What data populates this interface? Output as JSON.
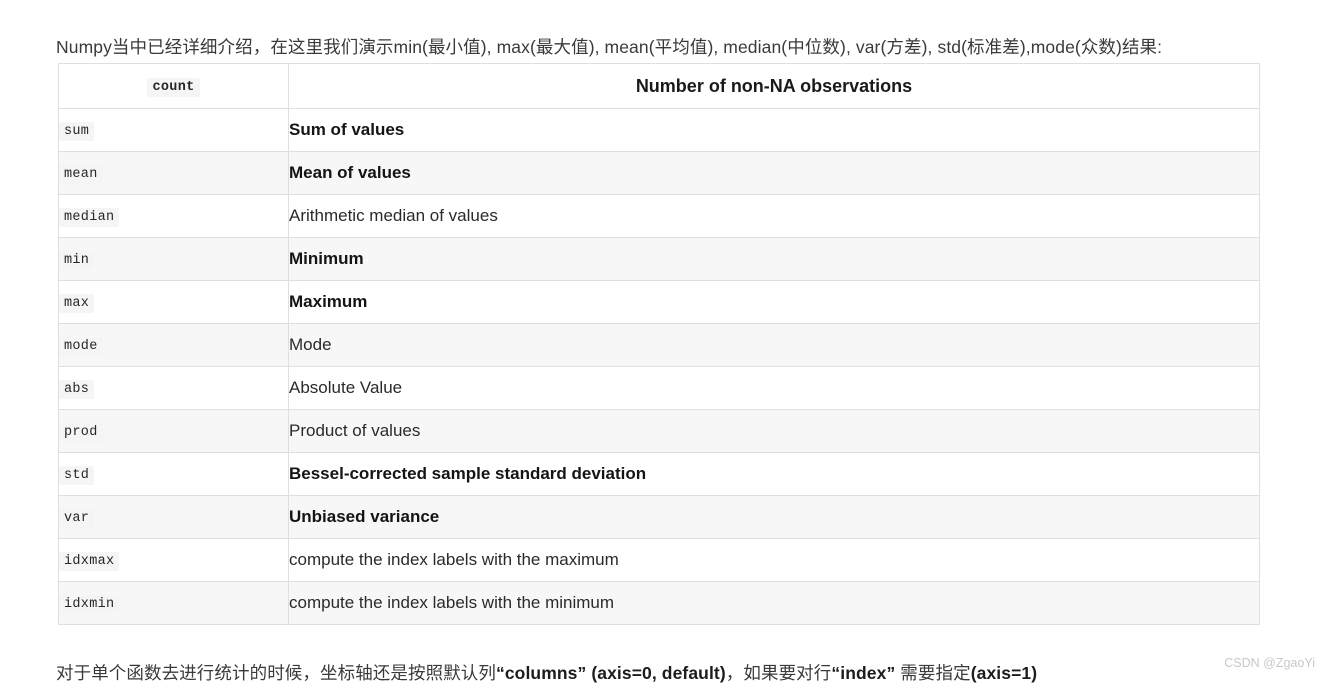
{
  "intro_text": "Numpy当中已经详细介绍，在这里我们演示min(最小值), max(最大值), mean(平均值), median(中位数), var(方差), std(标准差),mode(众数)结果:",
  "outro": {
    "part1": "对于单个函数去进行统计的时候，坐标轴还是按照默认列",
    "bold1": "“columns” (axis=0, default)",
    "part2": "，如果要对行",
    "bold2": "“index”",
    "part3": " 需要指定",
    "bold3": "(axis=1)"
  },
  "table": {
    "header": {
      "code": "count",
      "description": "Number of non-NA observations"
    },
    "rows": [
      {
        "code": "sum",
        "description": "Sum of values",
        "bold": true
      },
      {
        "code": "mean",
        "description": "Mean of values",
        "bold": true
      },
      {
        "code": "median",
        "description": "Arithmetic median of values",
        "bold": false
      },
      {
        "code": "min",
        "description": "Minimum",
        "bold": true
      },
      {
        "code": "max",
        "description": "Maximum",
        "bold": true
      },
      {
        "code": "mode",
        "description": "Mode",
        "bold": false
      },
      {
        "code": "abs",
        "description": "Absolute Value",
        "bold": false
      },
      {
        "code": "prod",
        "description": "Product of values",
        "bold": false
      },
      {
        "code": "std",
        "description": "Bessel-corrected sample standard deviation",
        "bold": true
      },
      {
        "code": "var",
        "description": "Unbiased variance",
        "bold": true
      },
      {
        "code": "idxmax",
        "description": "compute the index labels with the maximum",
        "bold": false
      },
      {
        "code": "idxmin",
        "description": "compute the index labels with the minimum",
        "bold": false
      }
    ]
  },
  "watermark": "CSDN @ZgaoYi",
  "colors": {
    "page_background": "#ffffff",
    "row_stripe": "#f7f7f7",
    "border": "#dfdfdf",
    "code_badge_background": "#f5f5f5",
    "text": "#2b2b2b",
    "watermark": "#c8c8c8"
  }
}
